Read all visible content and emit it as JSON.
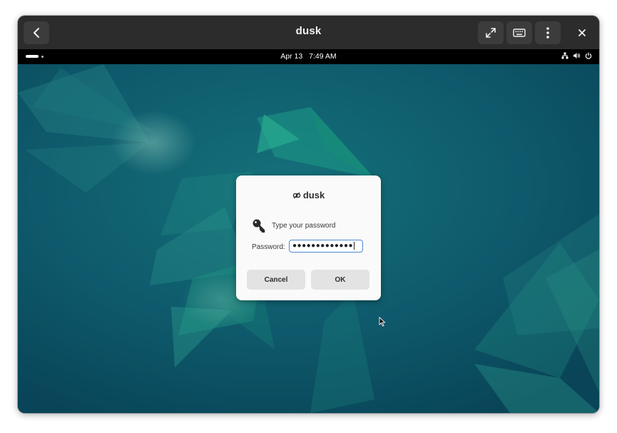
{
  "window": {
    "title": "dusk",
    "buttons": {
      "back": "back-icon",
      "fullscreen": "fullscreen-icon",
      "keyboard": "keyboard-icon",
      "menu": "kebab-menu-icon",
      "close": "close-icon"
    }
  },
  "topbar": {
    "date": "Apr 13",
    "time": "7:49 AM",
    "icons": [
      "network-icon",
      "volume-icon",
      "power-icon"
    ]
  },
  "dialog": {
    "brand": "dusk",
    "prompt": "Type your password",
    "password_label": "Password:",
    "password_value": "●●●●●●●●●●●●●",
    "cancel_label": "Cancel",
    "ok_label": "OK"
  },
  "colors": {
    "titlebar": "#2c2c2c",
    "desktop_bg": "#0c4f63",
    "accent": "#4f8ad4"
  }
}
